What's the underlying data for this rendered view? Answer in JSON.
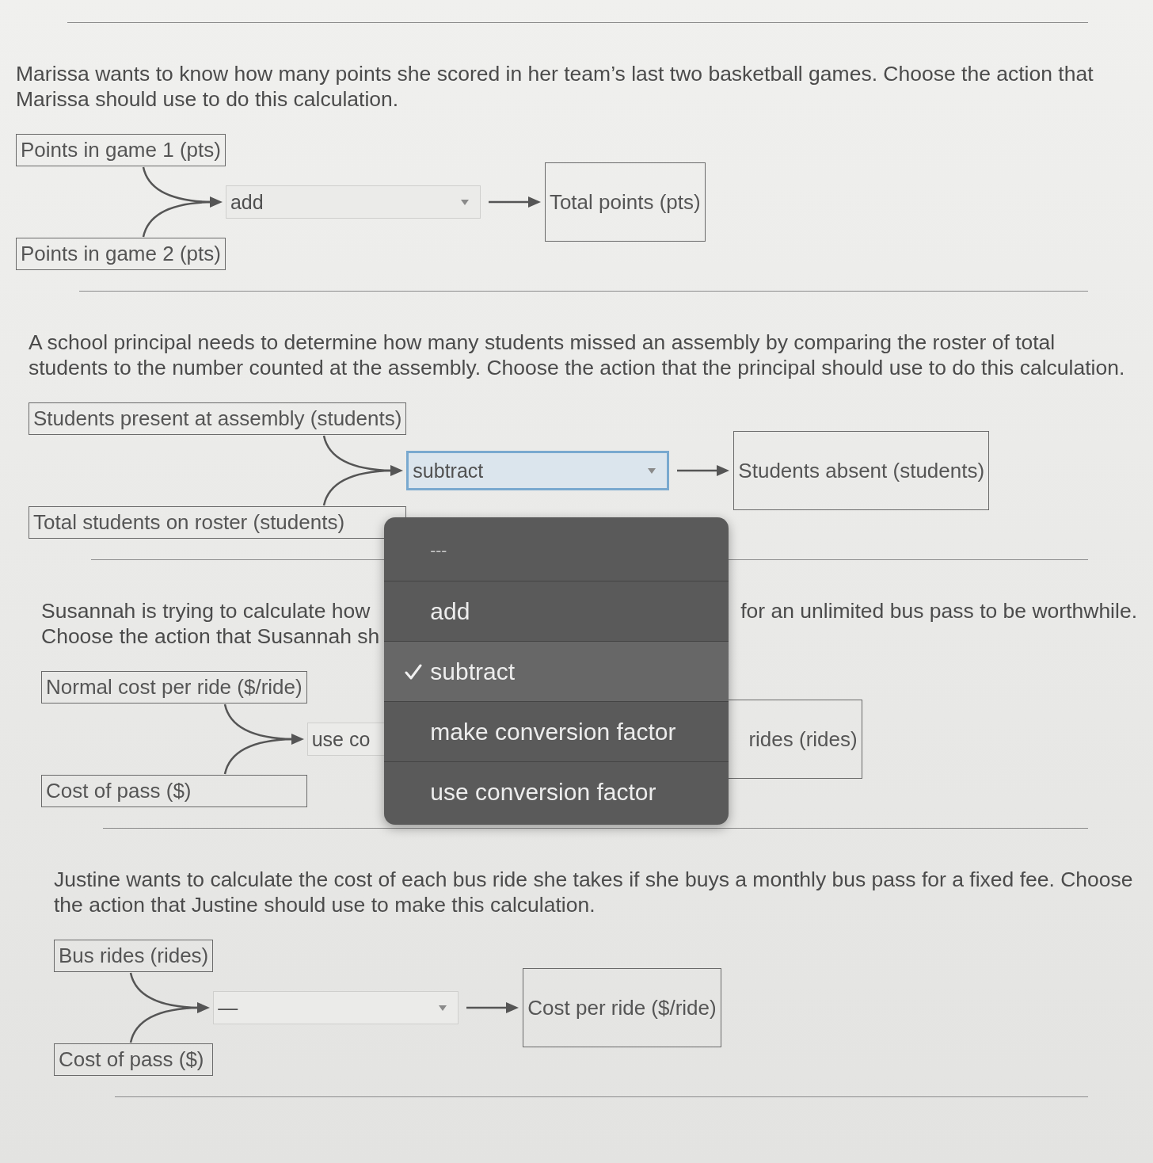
{
  "problems": [
    {
      "prompt": "Marissa wants to know how many points she scored in her team’s last two basketball games. Choose the action that Marissa should use to do this calculation.",
      "inputs": [
        "Points in game 1 (pts)",
        "Points in game 2 (pts)"
      ],
      "select": {
        "value": "add",
        "focused": false
      },
      "output": "Total points (pts)"
    },
    {
      "prompt": "A school principal needs to determine how many students missed an assembly by comparing the roster of total students to the number counted at the assembly. Choose the action that the principal should use to do this calculation.",
      "inputs": [
        "Students present at assembly (students)",
        "Total students on roster (students)"
      ],
      "select": {
        "value": "subtract",
        "focused": true,
        "menu": {
          "options": [
            {
              "label": "---",
              "selected": false
            },
            {
              "label": "add",
              "selected": false
            },
            {
              "label": "subtract",
              "selected": true
            },
            {
              "label": "make conversion factor",
              "selected": false
            },
            {
              "label": "use conversion factor",
              "selected": false
            }
          ]
        }
      },
      "output": "Students absent (students)"
    },
    {
      "prompt_lines": [
        {
          "left": "Susannah is trying to calculate how",
          "right": "for an unlimited bus pass to be worthwhile."
        },
        {
          "left": "Choose the action that Susannah sh"
        }
      ],
      "inputs": [
        "Normal cost per ride ($/ride)",
        "Cost of pass ($)"
      ],
      "select": {
        "value": "use co",
        "focused": false
      },
      "output": "rides (rides)"
    },
    {
      "prompt": "Justine wants to calculate the cost of each bus ride she takes if she buys a monthly bus pass for a fixed fee. Choose the action that Justine should use to make this calculation.",
      "inputs": [
        "Bus rides (rides)",
        "Cost of pass ($)"
      ],
      "select": {
        "value": "—",
        "focused": false
      },
      "output": "Cost per ride ($/ride)"
    }
  ]
}
